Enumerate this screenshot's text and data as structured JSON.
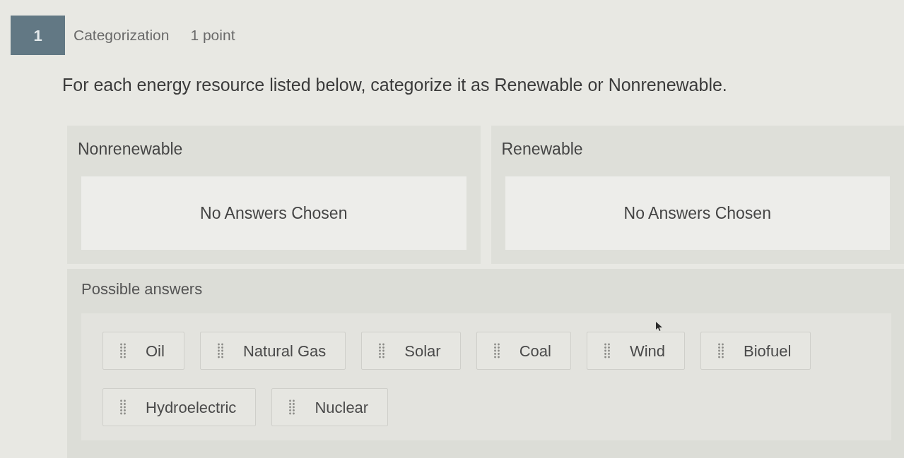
{
  "question": {
    "number": "1",
    "type": "Categorization",
    "points": "1 point",
    "prompt": "For each energy resource listed below, categorize it as Renewable or Nonrenewable."
  },
  "categories": [
    {
      "title": "Nonrenewable",
      "empty_text": "No Answers Chosen"
    },
    {
      "title": "Renewable",
      "empty_text": "No Answers Chosen"
    }
  ],
  "possible_answers": {
    "title": "Possible answers",
    "items": [
      "Oil",
      "Natural Gas",
      "Solar",
      "Coal",
      "Wind",
      "Biofuel",
      "Hydroelectric",
      "Nuclear"
    ]
  }
}
